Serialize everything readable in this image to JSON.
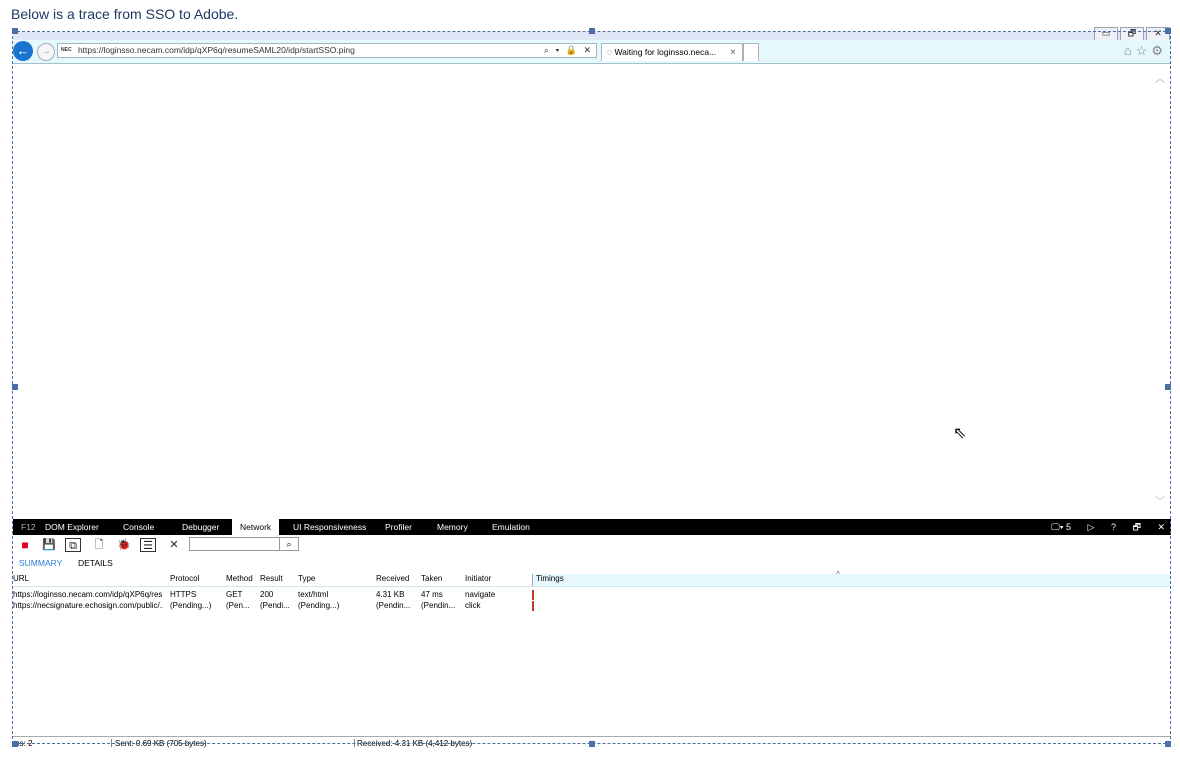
{
  "caption": "Below is a trace from SSO to Adobe.",
  "window": {
    "controls": [
      "▭",
      "🗗",
      "✕"
    ]
  },
  "browser": {
    "address": {
      "favicon_text": "NEC",
      "url": "https://loginsso.necam.com/idp/qXP6q/resumeSAML20/idp/startSSO.ping",
      "icons": "⌕ ▾ 🔒 ✕"
    },
    "tab": {
      "title": "Waiting for loginsso.neca...",
      "spinner": "◌",
      "close": "×"
    },
    "right_icons": [
      "home-icon",
      "star-icon",
      "gear-icon"
    ]
  },
  "devtools": {
    "f12_label": "F12",
    "tabs": [
      "DOM Explorer",
      "Console",
      "Debugger",
      "Network",
      "UI Responsiveness",
      "Profiler",
      "Memory",
      "Emulation"
    ],
    "active_tab": "Network",
    "right": {
      "emulation": "🖵▾ 5",
      "console": "▷",
      "help": "?",
      "undock": "🗗",
      "close": "✕"
    },
    "subtabs": [
      "SUMMARY",
      "DETAILS"
    ],
    "active_subtab": "SUMMARY",
    "columns": [
      "URL",
      "Protocol",
      "Method",
      "Result",
      "Type",
      "Received",
      "Taken",
      "Initiator",
      "Timings"
    ],
    "rows": [
      {
        "url": "https://loginsso.necam.com/idp/qXP6q/res...",
        "protocol": "HTTPS",
        "method": "GET",
        "result": "200",
        "type": "text/html",
        "received": "4.31 KB",
        "taken": "47 ms",
        "initiator": "navigate"
      },
      {
        "url": "https://necsignature.echosign.com/public/...",
        "protocol": "(Pending...)",
        "method": "(Pen...",
        "result": "(Pendi...",
        "type": "(Pending...)",
        "received": "(Pendin...",
        "taken": "(Pendin...",
        "initiator": "click"
      }
    ],
    "status": {
      "items": "ms: 2",
      "sent": "Sent: 0.69 KB (705 bytes)",
      "received": "Received: 4.31 KB (4,412 bytes)"
    }
  }
}
